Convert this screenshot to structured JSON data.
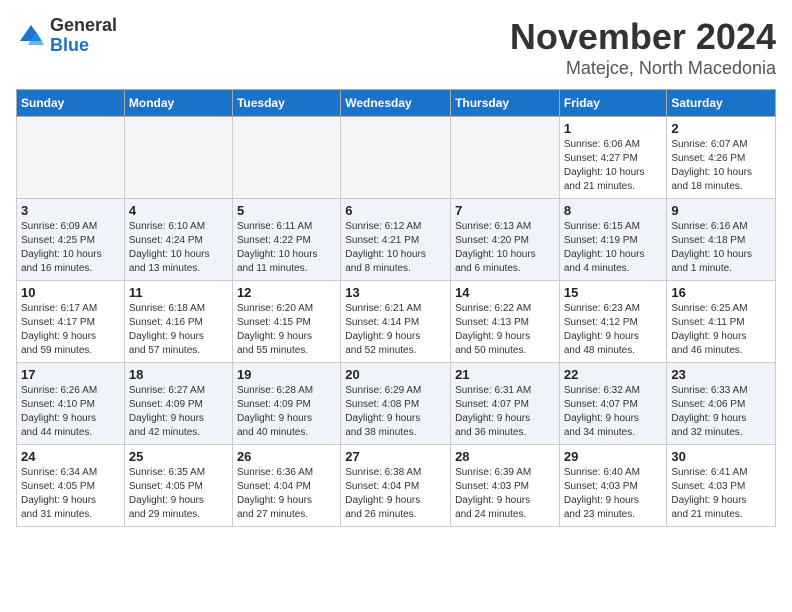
{
  "logo": {
    "general": "General",
    "blue": "Blue"
  },
  "title": "November 2024",
  "location": "Matejce, North Macedonia",
  "days_header": [
    "Sunday",
    "Monday",
    "Tuesday",
    "Wednesday",
    "Thursday",
    "Friday",
    "Saturday"
  ],
  "weeks": [
    [
      {
        "day": "",
        "info": ""
      },
      {
        "day": "",
        "info": ""
      },
      {
        "day": "",
        "info": ""
      },
      {
        "day": "",
        "info": ""
      },
      {
        "day": "",
        "info": ""
      },
      {
        "day": "1",
        "info": "Sunrise: 6:06 AM\nSunset: 4:27 PM\nDaylight: 10 hours\nand 21 minutes."
      },
      {
        "day": "2",
        "info": "Sunrise: 6:07 AM\nSunset: 4:26 PM\nDaylight: 10 hours\nand 18 minutes."
      }
    ],
    [
      {
        "day": "3",
        "info": "Sunrise: 6:09 AM\nSunset: 4:25 PM\nDaylight: 10 hours\nand 16 minutes."
      },
      {
        "day": "4",
        "info": "Sunrise: 6:10 AM\nSunset: 4:24 PM\nDaylight: 10 hours\nand 13 minutes."
      },
      {
        "day": "5",
        "info": "Sunrise: 6:11 AM\nSunset: 4:22 PM\nDaylight: 10 hours\nand 11 minutes."
      },
      {
        "day": "6",
        "info": "Sunrise: 6:12 AM\nSunset: 4:21 PM\nDaylight: 10 hours\nand 8 minutes."
      },
      {
        "day": "7",
        "info": "Sunrise: 6:13 AM\nSunset: 4:20 PM\nDaylight: 10 hours\nand 6 minutes."
      },
      {
        "day": "8",
        "info": "Sunrise: 6:15 AM\nSunset: 4:19 PM\nDaylight: 10 hours\nand 4 minutes."
      },
      {
        "day": "9",
        "info": "Sunrise: 6:16 AM\nSunset: 4:18 PM\nDaylight: 10 hours\nand 1 minute."
      }
    ],
    [
      {
        "day": "10",
        "info": "Sunrise: 6:17 AM\nSunset: 4:17 PM\nDaylight: 9 hours\nand 59 minutes."
      },
      {
        "day": "11",
        "info": "Sunrise: 6:18 AM\nSunset: 4:16 PM\nDaylight: 9 hours\nand 57 minutes."
      },
      {
        "day": "12",
        "info": "Sunrise: 6:20 AM\nSunset: 4:15 PM\nDaylight: 9 hours\nand 55 minutes."
      },
      {
        "day": "13",
        "info": "Sunrise: 6:21 AM\nSunset: 4:14 PM\nDaylight: 9 hours\nand 52 minutes."
      },
      {
        "day": "14",
        "info": "Sunrise: 6:22 AM\nSunset: 4:13 PM\nDaylight: 9 hours\nand 50 minutes."
      },
      {
        "day": "15",
        "info": "Sunrise: 6:23 AM\nSunset: 4:12 PM\nDaylight: 9 hours\nand 48 minutes."
      },
      {
        "day": "16",
        "info": "Sunrise: 6:25 AM\nSunset: 4:11 PM\nDaylight: 9 hours\nand 46 minutes."
      }
    ],
    [
      {
        "day": "17",
        "info": "Sunrise: 6:26 AM\nSunset: 4:10 PM\nDaylight: 9 hours\nand 44 minutes."
      },
      {
        "day": "18",
        "info": "Sunrise: 6:27 AM\nSunset: 4:09 PM\nDaylight: 9 hours\nand 42 minutes."
      },
      {
        "day": "19",
        "info": "Sunrise: 6:28 AM\nSunset: 4:09 PM\nDaylight: 9 hours\nand 40 minutes."
      },
      {
        "day": "20",
        "info": "Sunrise: 6:29 AM\nSunset: 4:08 PM\nDaylight: 9 hours\nand 38 minutes."
      },
      {
        "day": "21",
        "info": "Sunrise: 6:31 AM\nSunset: 4:07 PM\nDaylight: 9 hours\nand 36 minutes."
      },
      {
        "day": "22",
        "info": "Sunrise: 6:32 AM\nSunset: 4:07 PM\nDaylight: 9 hours\nand 34 minutes."
      },
      {
        "day": "23",
        "info": "Sunrise: 6:33 AM\nSunset: 4:06 PM\nDaylight: 9 hours\nand 32 minutes."
      }
    ],
    [
      {
        "day": "24",
        "info": "Sunrise: 6:34 AM\nSunset: 4:05 PM\nDaylight: 9 hours\nand 31 minutes."
      },
      {
        "day": "25",
        "info": "Sunrise: 6:35 AM\nSunset: 4:05 PM\nDaylight: 9 hours\nand 29 minutes."
      },
      {
        "day": "26",
        "info": "Sunrise: 6:36 AM\nSunset: 4:04 PM\nDaylight: 9 hours\nand 27 minutes."
      },
      {
        "day": "27",
        "info": "Sunrise: 6:38 AM\nSunset: 4:04 PM\nDaylight: 9 hours\nand 26 minutes."
      },
      {
        "day": "28",
        "info": "Sunrise: 6:39 AM\nSunset: 4:03 PM\nDaylight: 9 hours\nand 24 minutes."
      },
      {
        "day": "29",
        "info": "Sunrise: 6:40 AM\nSunset: 4:03 PM\nDaylight: 9 hours\nand 23 minutes."
      },
      {
        "day": "30",
        "info": "Sunrise: 6:41 AM\nSunset: 4:03 PM\nDaylight: 9 hours\nand 21 minutes."
      }
    ]
  ]
}
